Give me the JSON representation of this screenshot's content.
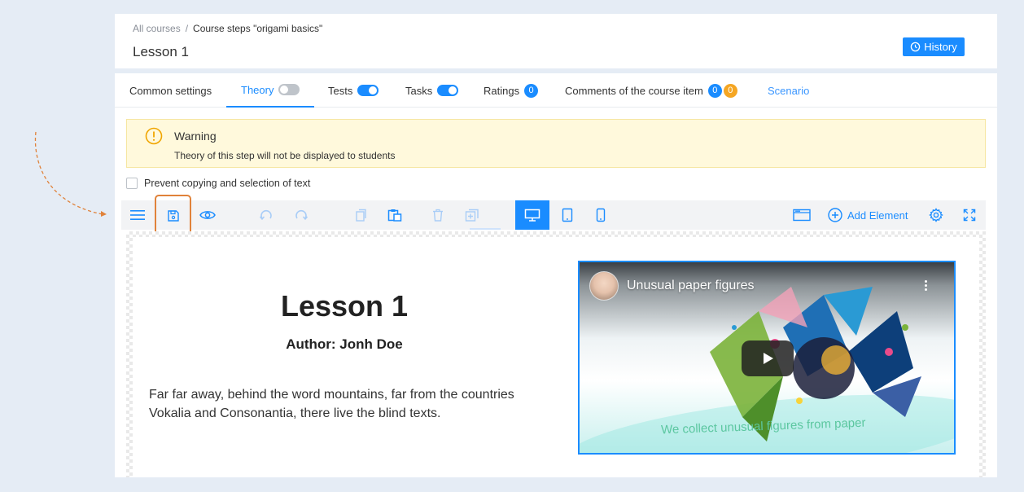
{
  "breadcrumb": {
    "root": "All courses",
    "separator": "/",
    "current": "Course steps \"origami basics\""
  },
  "page": {
    "title": "Lesson 1",
    "history_label": "History"
  },
  "tabs": [
    {
      "label": "Common settings"
    },
    {
      "label": "Theory",
      "toggle": "off",
      "active": true
    },
    {
      "label": "Tests",
      "toggle": "on"
    },
    {
      "label": "Tasks",
      "toggle": "on"
    },
    {
      "label": "Ratings",
      "badge": "0"
    },
    {
      "label": "Comments of the course item",
      "badge_blue": "0",
      "badge_orange": "0"
    },
    {
      "label": "Scenario"
    }
  ],
  "warning": {
    "title": "Warning",
    "text": "Theory of this step will not be displayed to students"
  },
  "prevent_copy": {
    "label": "Prevent copying and selection of text",
    "checked": false
  },
  "toolbar": {
    "add_element_label": "Add Element",
    "active_device": "desktop",
    "icons": [
      "menu-icon",
      "save-icon",
      "eye-icon",
      "undo-icon",
      "redo-icon",
      "copy-icon",
      "paste-icon",
      "trash-icon",
      "duplicate-icon",
      "desktop-icon",
      "tablet-icon",
      "mobile-icon",
      "window-icon",
      "add-circle-icon",
      "gear-icon",
      "fullscreen-icon"
    ]
  },
  "content": {
    "heading": "Lesson 1",
    "author": "Author: Jonh Doe",
    "body": "Far far away, behind the word mountains, far from the countries Vokalia and Consonantia, there live the blind texts."
  },
  "video": {
    "title": "Unusual paper figures",
    "caption": "We collect unusual figures from paper"
  },
  "colors": {
    "accent": "#1a8cff",
    "badge_orange": "#f5a623",
    "highlight_outline": "#e0823a",
    "warning_bg": "#fff9dc",
    "page_bg": "#e5ecf5"
  }
}
